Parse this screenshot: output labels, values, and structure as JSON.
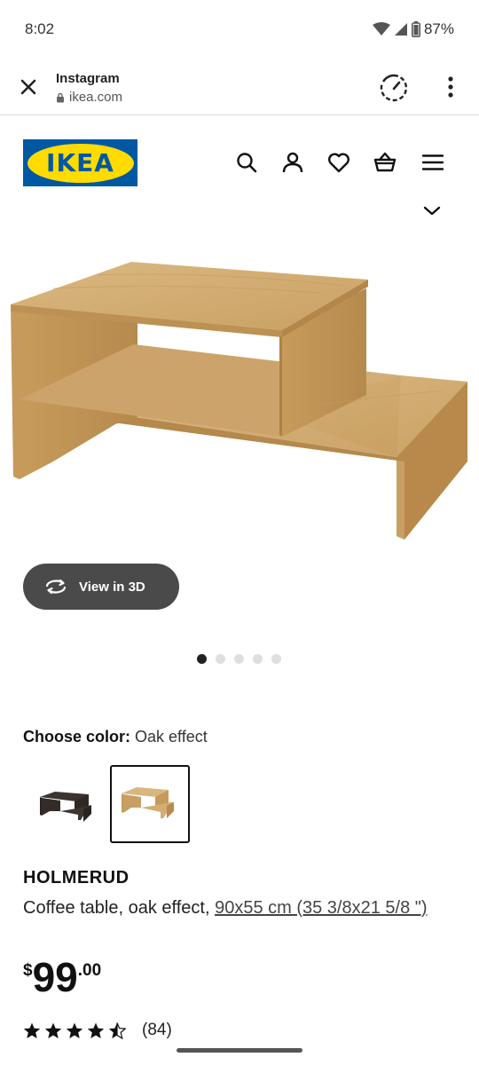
{
  "status_bar": {
    "time": "8:02",
    "battery": "87%"
  },
  "browser": {
    "title": "Instagram",
    "url": "ikea.com",
    "icons": [
      "close-icon",
      "lock-icon",
      "speed-icon",
      "more-vertical-icon"
    ]
  },
  "header": {
    "logo_text": "IKEA",
    "icons": [
      "search-icon",
      "account-icon",
      "heart-icon",
      "basket-icon",
      "menu-icon"
    ]
  },
  "gallery": {
    "view_3d_label": "View in 3D",
    "dots_total": 5,
    "active_dot": 1
  },
  "colors": {
    "label": "Choose color:",
    "selected_value": "Oak effect",
    "swatches": [
      {
        "name": "Dark brown",
        "selected": false
      },
      {
        "name": "Oak effect",
        "selected": true
      }
    ]
  },
  "product": {
    "name": "HOLMERUD",
    "description": "Coffee table, oak effect, ",
    "dimensions": "90x55 cm (35 3/8x21 5/8 \")",
    "price_currency": "$",
    "price_main": "99",
    "price_decimal": ".00",
    "rating_stars": 4.5,
    "review_count": "(84)"
  },
  "theme": {
    "ikea_blue": "#0058a3",
    "ikea_yellow": "#ffdb00",
    "button_dark": "#4a4a4a"
  }
}
